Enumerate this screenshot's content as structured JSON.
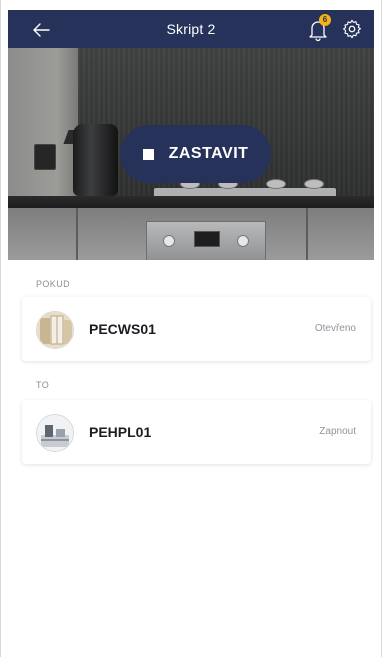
{
  "header": {
    "title": "Skript 2",
    "notification_count": "6"
  },
  "hero": {
    "stop_label": "ZASTAVIT"
  },
  "sections": {
    "if_label": "POKUD",
    "then_label": "TO"
  },
  "devices": [
    {
      "name": "PECWS01",
      "state": "Otevřeno"
    },
    {
      "name": "PEHPL01",
      "state": "Zapnout"
    }
  ],
  "colors": {
    "header_bg": "#26325a",
    "badge": "#f5b316",
    "background": "#ffffff"
  },
  "icons": {
    "back": "arrow-left-icon",
    "notifications": "bell-icon",
    "settings": "gear-icon",
    "stop": "stop-square-icon"
  }
}
